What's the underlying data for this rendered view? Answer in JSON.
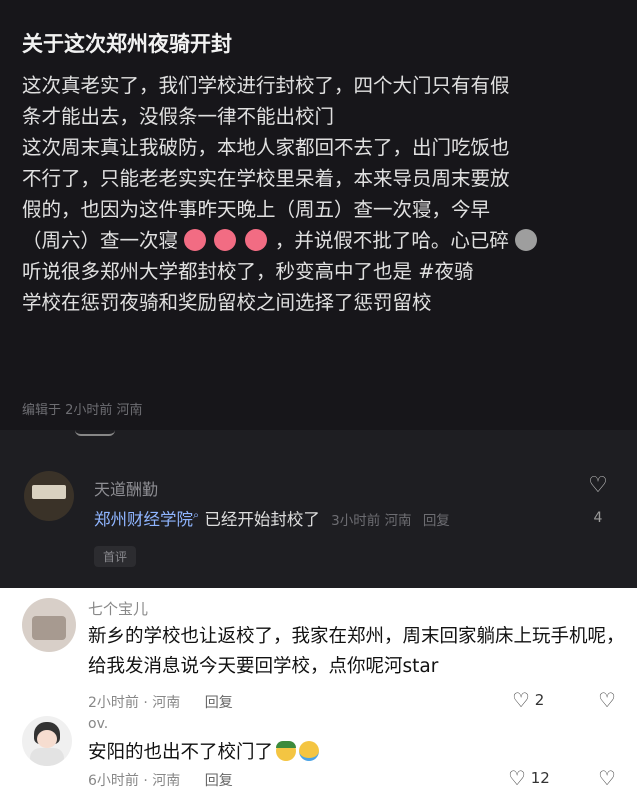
{
  "post": {
    "title": "关于这次郑州夜骑开封",
    "lines": [
      "这次真老实了，我们学校进行封校了，四个大门只有有假",
      "条才能出去，没假条一律不能出校门",
      "这次周末真让我破防，本地人家都回不去了，出门吃饭也",
      "不行了，只能老老实实在学校里呆着，本来导员周末要放",
      "假的，也因为这件事昨天晚上（周五）查一次寝，今早"
    ],
    "line6_start": "（周六）查一次寝",
    "line6_end": "，并说假不批了哈。心已碎",
    "line7_start": "听说很多郑州大学都封校了，秒变高中了也是",
    "line7_tag": "#夜骑",
    "line8": "学校在惩罚夜骑和奖励留校之间选择了惩罚留校",
    "meta": "编辑于 2小时前 河南"
  },
  "comment1": {
    "author": "天道酬勤",
    "link": "郑州财经学院",
    "link_icon": "search-icon",
    "text": "已经开始封校了",
    "meta": "3小时前 河南",
    "reply": "回复",
    "likes": "4",
    "badge": "首评"
  },
  "comment2": {
    "author": "七个宝儿",
    "text": "新乡的学校也让返校了，我家在郑州，周末回家躺床上玩手机呢，给我发消息说今天要回学校，点你呢河star",
    "meta": "2小时前 · 河南",
    "reply": "回复",
    "likes": "2"
  },
  "comment3": {
    "author": "ov.",
    "text": "安阳的也出不了校门了",
    "meta": "6小时前 · 河南",
    "reply": "回复",
    "likes": "12"
  },
  "colors": {
    "dark_bg": "#17161a",
    "dark_panel": "#1e1e22",
    "link_blue": "#8fb5ff"
  }
}
